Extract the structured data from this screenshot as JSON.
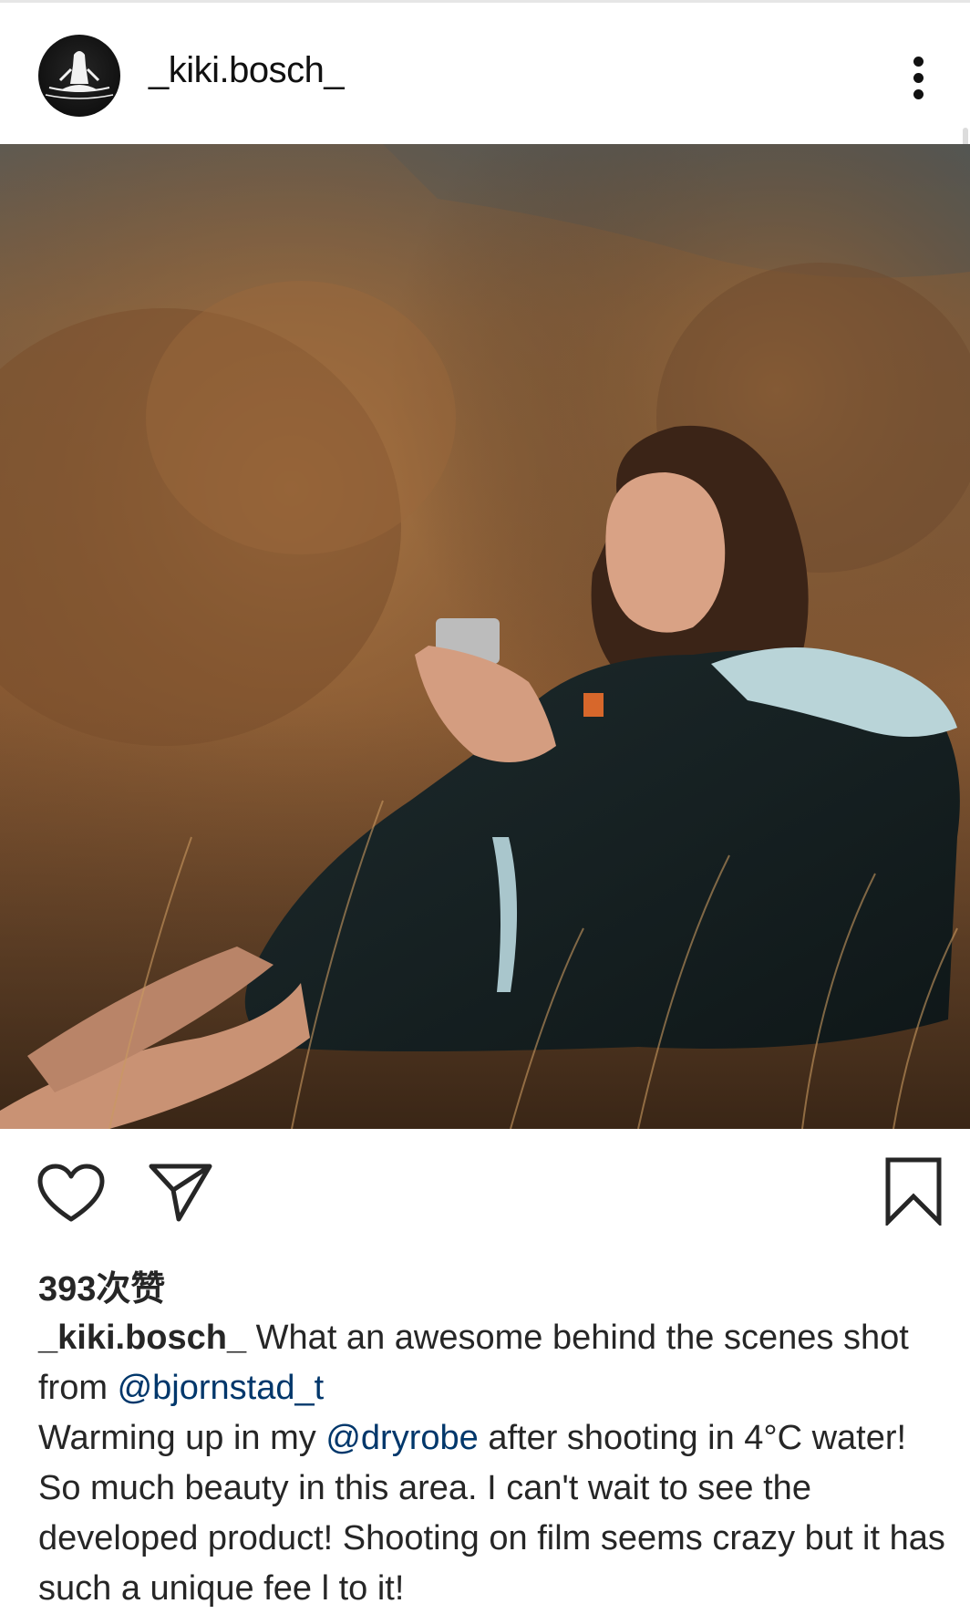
{
  "post": {
    "username": "_kiki.bosch_",
    "more_icon": "more-vertical-icon",
    "likes_text": "393次赞",
    "caption": {
      "author": "_kiki.bosch_",
      "part1": " What an awesome behind the scenes shot from ",
      "mention1": "@bjornstad_t",
      "part2": "Warming up in my ",
      "mention2": "@dryrobe",
      "part3": " after shooting in 4°C water! So much beauty in this area. I can't wait to see the developed product! Shooting on film seems crazy but it has such a unique fee l to it!"
    }
  },
  "actions": {
    "like_icon": "heart-icon",
    "share_icon": "send-icon",
    "save_icon": "bookmark-icon"
  },
  "colors": {
    "text": "#262626",
    "mention": "#00376b",
    "background": "#ffffff"
  }
}
